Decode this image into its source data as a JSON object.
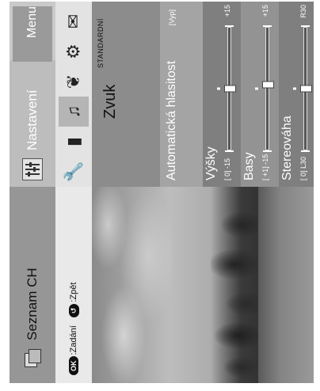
{
  "header": {
    "menu_title": "Menu",
    "tab_channels": "Seznam CH",
    "tab_settings": "Nastavení"
  },
  "hints": {
    "ok_badge": "OK",
    "ok_label": ":Zadání",
    "back_badge": "↺",
    "back_label": ":Zpět"
  },
  "icons": [
    "wrench-icon",
    "picture-icon",
    "sound-icon",
    "leaf-icon",
    "gear-icon",
    "mail-icon"
  ],
  "icon_selected": "sound-icon",
  "section": {
    "title": "Zvuk",
    "mode": "STANDARDNÍ"
  },
  "auto_volume": {
    "label": "Automatická hlasitost",
    "value": "[Vyp]"
  },
  "sliders": [
    {
      "key": "vysky",
      "label": "Výšky",
      "value_text": "[   0]",
      "min": "-15",
      "max": "+15",
      "level": 0.5
    },
    {
      "key": "basy",
      "label": "Basy",
      "value_text": "[  +1]",
      "min": "-15",
      "max": "+15",
      "level": 0.53
    },
    {
      "key": "stereo",
      "label": "Stereováha",
      "value_text": "[   0]",
      "min": "L30",
      "max": "R30",
      "level": 0.5
    }
  ]
}
